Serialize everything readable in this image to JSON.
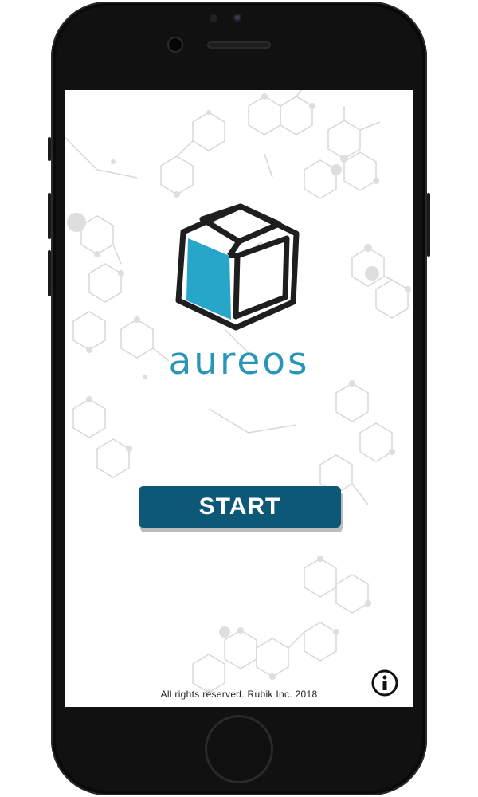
{
  "app": {
    "brand_name": "aureos",
    "start_label": "START",
    "copyright": "All rights reserved. Rubik Inc. 2018",
    "info_icon": "info-icon",
    "logo_icon": "cube-logo-icon"
  },
  "colors": {
    "brand_text": "#2a95b9",
    "button_bg": "#0d5777",
    "logo_face": "#28a6c9",
    "phone_body": "#111111"
  }
}
